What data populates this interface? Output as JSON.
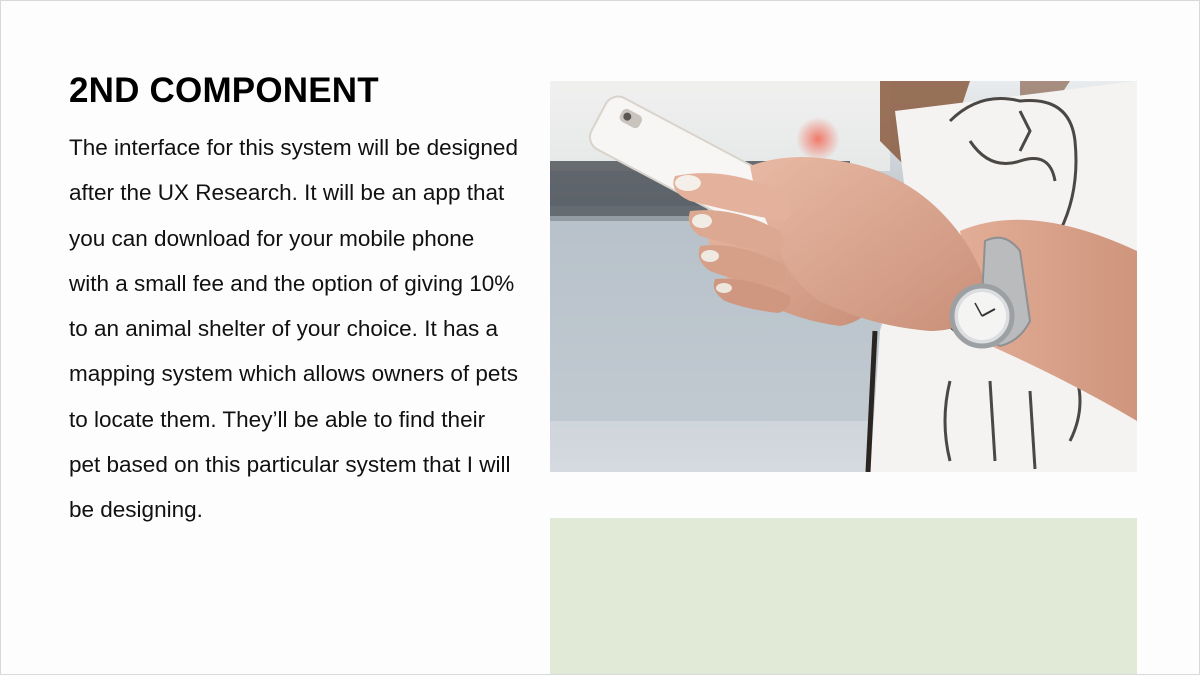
{
  "slide": {
    "title": "2ND COMPONENT",
    "body": "The interface for this system will be designed after the UX Research. It will be an app that you can download for your mobile phone with a small fee and the option of giving 10% to an animal shelter of your choice. It has a mapping system which allows owners of pets to locate them. They’ll be able to find their pet based on this particular system that I will be designing.",
    "photo_icon": "photo-hands-smartphone-icon",
    "colors": {
      "background": "#fefdfe",
      "accent_block": "#e1ead6",
      "text": "#111111"
    }
  }
}
